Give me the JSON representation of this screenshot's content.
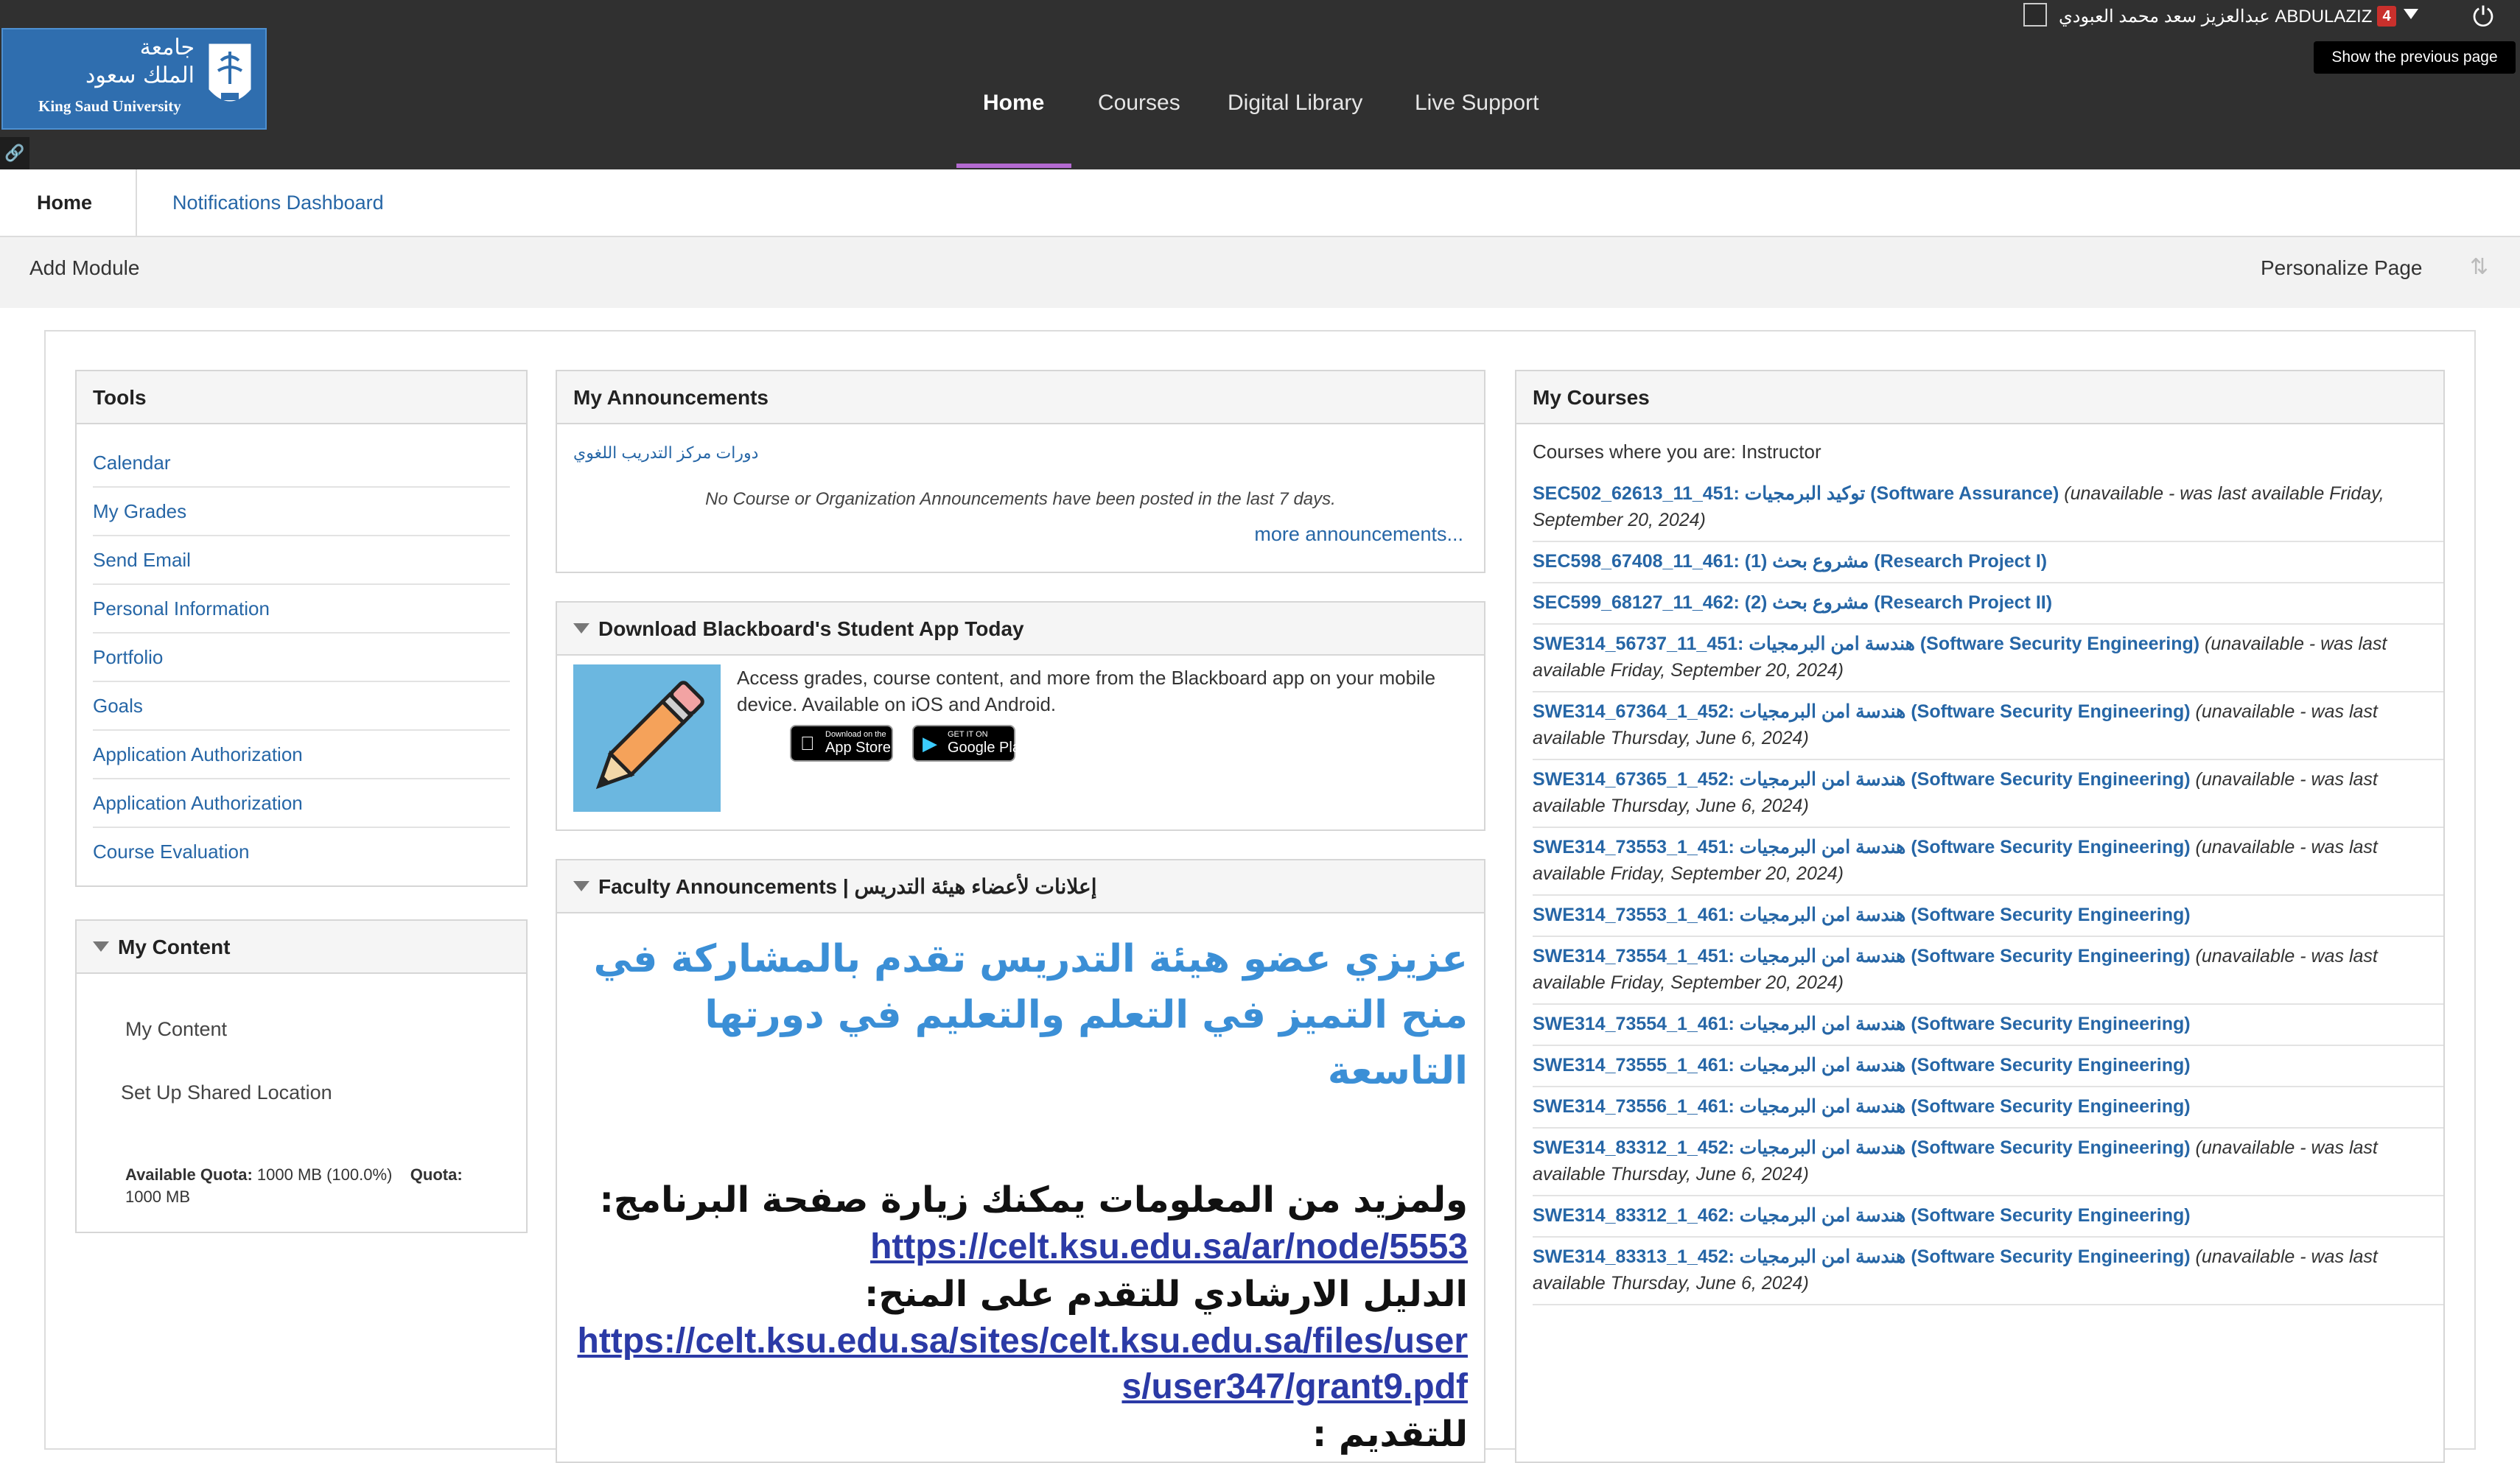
{
  "header": {
    "logo": {
      "arabic_line1": "جامعة",
      "arabic_line2": "الملك سعود",
      "english": "King Saud University"
    },
    "nav": [
      {
        "label": "Home",
        "active": true
      },
      {
        "label": "Courses"
      },
      {
        "label": "Digital Library"
      },
      {
        "label": "Live Support"
      }
    ],
    "user_name": "عبدالعزيز سعد محمد العبودي ABDULAZIZ ...",
    "notification_count": "4",
    "tooltip": "Show the previous page",
    "accent_color": "#b46ad1"
  },
  "tabs": {
    "home": "Home",
    "notifications": "Notifications Dashboard"
  },
  "actions": {
    "add_module": "Add Module",
    "personalize": "Personalize Page"
  },
  "tools": {
    "title": "Tools",
    "items": [
      "Calendar",
      "My Grades",
      "Send Email",
      "Personal Information",
      "Portfolio",
      "Goals",
      "Application Authorization",
      "Application Authorization",
      "Course Evaluation"
    ]
  },
  "my_content": {
    "title": "My Content",
    "link": "My Content",
    "shared": "Set Up Shared Location",
    "available_quota_label": "Available Quota:",
    "available_quota_value": "1000 MB (100.0%)",
    "quota_label": "Quota:",
    "quota_value": "1000 MB"
  },
  "announcements": {
    "title": "My Announcements",
    "link": "دورات مركز التدريب اللغوي",
    "none": "No Course or Organization Announcements have been posted in the last 7 days.",
    "more": "more announcements..."
  },
  "app": {
    "title": "Download Blackboard's Student App Today",
    "text": "Access grades, course content, and more from the Blackboard app on your mobile device. Available on iOS and Android.",
    "appstore_small": "Download on the",
    "appstore": "App Store",
    "google_small": "GET IT ON",
    "google": "Google Play"
  },
  "faculty": {
    "title": "Faculty Announcements | إعلانات لأعضاء هيئة التدريس",
    "headline": "عزيزي عضو هيئة التدريس تقدم بالمشاركة في منح التميز في التعلم والتعليم في دورتها التاسعة",
    "more_info": "ولمزيد من المعلومات يمكنك زيارة صفحة البرنامج:",
    "url1": "https://celt.ksu.edu.sa/ar/node/5553",
    "guide": "الدليل الارشادي للتقدم على المنح:",
    "url2": "https://celt.ksu.edu.sa/sites/celt.ksu.edu.sa/files/users/user347/grant9.pdf",
    "apply": "للتقديم :"
  },
  "courses": {
    "title": "My Courses",
    "role": "Courses where you are: Instructor",
    "items": [
      {
        "name": "SEC502_62613_11_451: توكيد البرمجيات (Software Assurance)",
        "note": " (unavailable - was last available Friday, September 20, 2024)"
      },
      {
        "name": "SEC598_67408_11_461: مشروع بحث (1) (Research Project I)",
        "note": ""
      },
      {
        "name": "SEC599_68127_11_462: مشروع بحث (2) (Research Project II)",
        "note": ""
      },
      {
        "name": "SWE314_56737_11_451: هندسة امن البرمجيات (Software Security Engineering)",
        "note": " (unavailable - was last available Friday, September 20, 2024)"
      },
      {
        "name": "SWE314_67364_1_452: هندسة امن البرمجيات (Software Security Engineering)",
        "note": " (unavailable - was last available Thursday, June 6, 2024)"
      },
      {
        "name": "SWE314_67365_1_452: هندسة امن البرمجيات (Software Security Engineering)",
        "note": " (unavailable - was last available Thursday, June 6, 2024)"
      },
      {
        "name": "SWE314_73553_1_451: هندسة امن البرمجيات (Software Security Engineering)",
        "note": " (unavailable - was last available Friday, September 20, 2024)"
      },
      {
        "name": "SWE314_73553_1_461: هندسة امن البرمجيات (Software Security Engineering)",
        "note": ""
      },
      {
        "name": "SWE314_73554_1_451: هندسة امن البرمجيات (Software Security Engineering)",
        "note": " (unavailable - was last available Friday, September 20, 2024)"
      },
      {
        "name": "SWE314_73554_1_461: هندسة امن البرمجيات (Software Security Engineering)",
        "note": ""
      },
      {
        "name": "SWE314_73555_1_461: هندسة امن البرمجيات (Software Security Engineering)",
        "note": ""
      },
      {
        "name": "SWE314_73556_1_461: هندسة امن البرمجيات (Software Security Engineering)",
        "note": ""
      },
      {
        "name": "SWE314_83312_1_452: هندسة امن البرمجيات (Software Security Engineering)",
        "note": " (unavailable - was last available Thursday, June 6, 2024)"
      },
      {
        "name": "SWE314_83312_1_462: هندسة امن البرمجيات (Software Security Engineering)",
        "note": ""
      },
      {
        "name": "SWE314_83313_1_452: هندسة امن البرمجيات (Software Security Engineering)",
        "note": " (unavailable - was last available Thursday, June 6, 2024)"
      }
    ]
  }
}
